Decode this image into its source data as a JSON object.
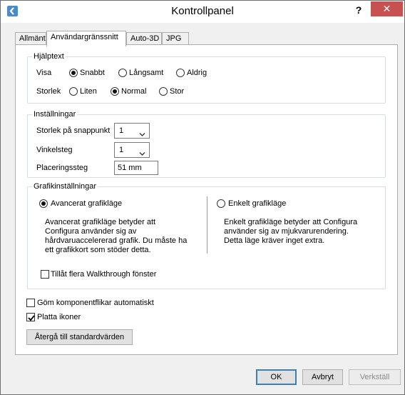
{
  "window": {
    "title": "Kontrollpanel",
    "help": "?",
    "close": "✕"
  },
  "tabs": [
    "Allmänt",
    "Användargränssnitt",
    "Auto-3D",
    "JPG"
  ],
  "help_text": {
    "legend": "Hjälptext",
    "show_label": "Visa",
    "show_options": [
      "Snabbt",
      "Långsamt",
      "Aldrig"
    ],
    "show_selected": "Snabbt",
    "size_label": "Storlek",
    "size_options": [
      "Liten",
      "Normal",
      "Stor"
    ],
    "size_selected": "Normal"
  },
  "settings": {
    "legend": "Inställningar",
    "snap_label": "Storlek på snappunkt",
    "snap_value": "1",
    "angle_label": "Vinkelsteg",
    "angle_value": "1",
    "placement_label": "Placeringssteg",
    "placement_value": "51 mm"
  },
  "graphics": {
    "legend": "Grafikinställningar",
    "advanced_label": "Avancerat grafikläge",
    "advanced_selected": true,
    "advanced_desc": [
      "Avancerat grafikläge betyder att",
      "Configura använder sig av",
      "hårdvaruaccelererad grafik. Du måste ha",
      "ett grafikkort som stöder detta."
    ],
    "simple_label": "Enkelt grafikläge",
    "simple_selected": false,
    "simple_desc": [
      "Enkelt grafikläge betyder att Configura",
      "använder sig av mjukvarurendering.",
      "Detta läge kräver inget extra."
    ],
    "walkthrough_label": "Tillåt flera Walkthrough fönster",
    "walkthrough_checked": false
  },
  "hide_tabs_label": "Göm komponentflikar automatiskt",
  "hide_tabs_checked": false,
  "flat_icons_label": "Platta ikoner",
  "flat_icons_checked": true,
  "reset_label": "Återgå till standardvärden",
  "buttons": {
    "ok": "OK",
    "cancel": "Avbryt",
    "apply": "Verkställ"
  }
}
